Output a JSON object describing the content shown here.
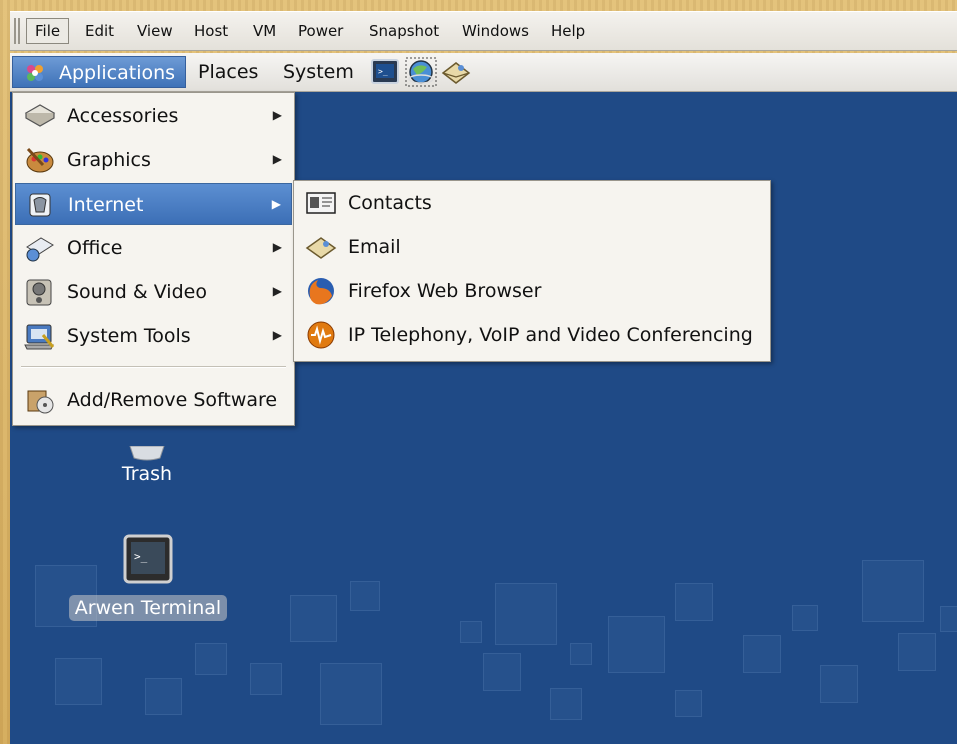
{
  "vm_menubar": {
    "items": [
      "File",
      "Edit",
      "View",
      "Host",
      "VM",
      "Power",
      "Snapshot",
      "Windows",
      "Help"
    ]
  },
  "panel": {
    "applications": "Applications",
    "places": "Places",
    "system": "System",
    "launchers": [
      "terminal-launcher-icon",
      "browser-launcher-icon",
      "email-launcher-icon"
    ]
  },
  "applications_menu": {
    "items": [
      {
        "label": "Accessories",
        "icon": "accessories-icon",
        "submenu": true
      },
      {
        "label": "Graphics",
        "icon": "graphics-icon",
        "submenu": true
      },
      {
        "label": "Internet",
        "icon": "internet-icon",
        "submenu": true,
        "highlighted": true
      },
      {
        "label": "Office",
        "icon": "office-icon",
        "submenu": true
      },
      {
        "label": "Sound & Video",
        "icon": "sound-video-icon",
        "submenu": true
      },
      {
        "label": "System Tools",
        "icon": "system-tools-icon",
        "submenu": true
      },
      {
        "label": "Add/Remove Software",
        "icon": "add-remove-software-icon",
        "submenu": false
      }
    ]
  },
  "internet_submenu": {
    "items": [
      {
        "label": "Contacts",
        "icon": "contacts-icon"
      },
      {
        "label": "Email",
        "icon": "email-icon"
      },
      {
        "label": "Firefox Web Browser",
        "icon": "firefox-icon"
      },
      {
        "label": "IP Telephony, VoIP and Video Conferencing",
        "icon": "voip-icon"
      }
    ]
  },
  "desktop": {
    "trash_label": "Trash",
    "terminal_label": "Arwen Terminal"
  }
}
